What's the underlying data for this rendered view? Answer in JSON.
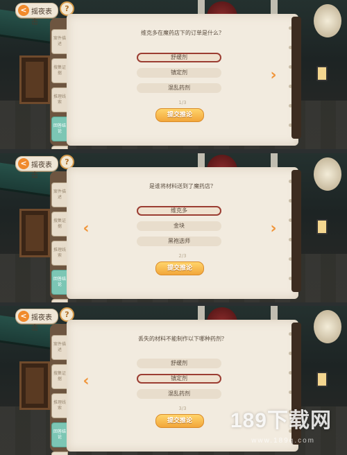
{
  "panels": [
    {
      "top_button": "摇夜表击",
      "tabs": [
        "案件描述",
        "搜集证据",
        "推理线索",
        "回答结论"
      ],
      "question": "维克多在魔药店下的订单是什么？",
      "options": [
        "舒缓剂",
        "镇定剂",
        "混乱药剂"
      ],
      "selected_index": 0,
      "counter": "1/3",
      "submit_label": "提交推论",
      "show_left_arrow": false,
      "show_right_arrow": true
    },
    {
      "top_button": "摇夜表击",
      "tabs": [
        "案件描述",
        "搜集证据",
        "推理线索",
        "回答结论"
      ],
      "question": "是谁将材料送到了魔药店？",
      "options": [
        "维克多",
        "金块",
        "黑袍选师"
      ],
      "selected_index": 0,
      "counter": "2/3",
      "submit_label": "提交推论",
      "show_left_arrow": true,
      "show_right_arrow": true
    },
    {
      "top_button": "摇夜表击",
      "tabs": [
        "案件描述",
        "搜集证据",
        "推理线索",
        "回答结论"
      ],
      "question": "丢失的材料不能制作以下哪种药剂？",
      "options": [
        "舒缓剂",
        "镇定剂",
        "混乱药剂"
      ],
      "selected_index": 1,
      "counter": "3/3",
      "submit_label": "提交推论",
      "show_left_arrow": true,
      "show_right_arrow": false
    }
  ],
  "icons": {
    "back": "left-arrow-icon",
    "help": "question-mark-icon",
    "prev": "chevron-left-icon",
    "next": "chevron-right-icon",
    "settings": "gear-icon"
  },
  "help_label": "?",
  "watermark": {
    "text": "189下载网",
    "url": "www.189q.com"
  },
  "colors": {
    "accent": "#f0953a",
    "selected_border": "#9b3d32",
    "active_tab": "#7cc6b4",
    "paper": "#f2ebdf"
  }
}
